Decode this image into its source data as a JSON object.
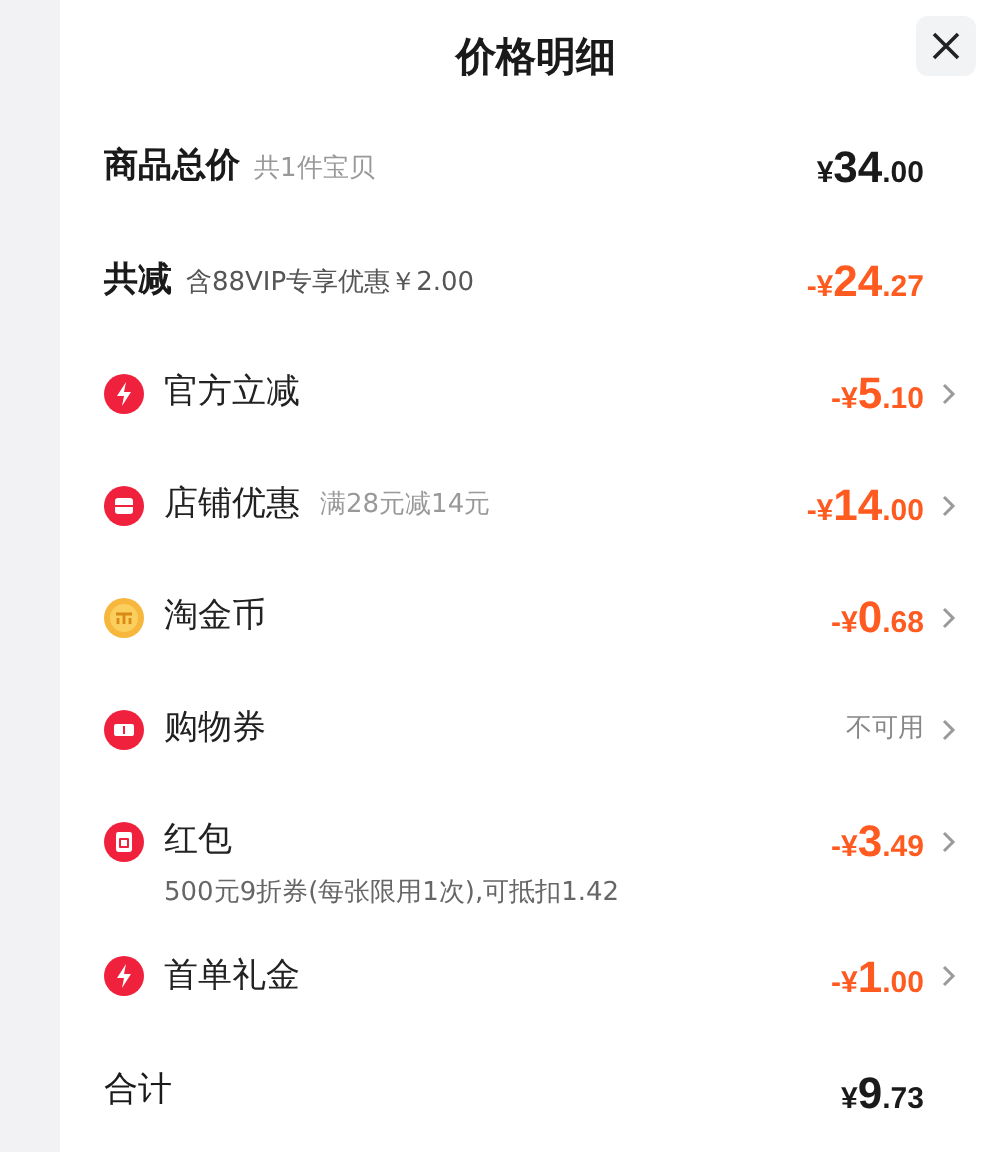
{
  "title": "价格明细",
  "summary": [
    {
      "label": "商品总价",
      "note": "共1件宝贝",
      "price": {
        "sign": "¥",
        "whole": "34",
        "cents": ".00"
      },
      "discount": false
    },
    {
      "label": "共减",
      "note": "含88VIP专享优惠￥2.00",
      "price": {
        "sign": "-¥",
        "whole": "24",
        "cents": ".27"
      },
      "discount": true
    }
  ],
  "items": [
    {
      "kind": "bolt",
      "label": "官方立减",
      "price": {
        "sign": "-¥",
        "whole": "5",
        "cents": ".10"
      }
    },
    {
      "kind": "shop",
      "label": "店铺优惠",
      "note": "满28元减14元",
      "price": {
        "sign": "-¥",
        "whole": "14",
        "cents": ".00"
      }
    },
    {
      "kind": "coin",
      "label": "淘金币",
      "price": {
        "sign": "-¥",
        "whole": "0",
        "cents": ".68"
      }
    },
    {
      "kind": "ticket",
      "label": "购物券",
      "status": "不可用"
    },
    {
      "kind": "redpacket",
      "label": "红包",
      "price": {
        "sign": "-¥",
        "whole": "3",
        "cents": ".49"
      },
      "detail": "500元9折券(每张限用1次),可抵扣1.42"
    },
    {
      "kind": "bolt",
      "label": "首单礼金",
      "price": {
        "sign": "-¥",
        "whole": "1",
        "cents": ".00"
      }
    }
  ],
  "total": {
    "label": "合计",
    "price": {
      "sign": "¥",
      "whole": "9",
      "cents": ".73"
    }
  }
}
